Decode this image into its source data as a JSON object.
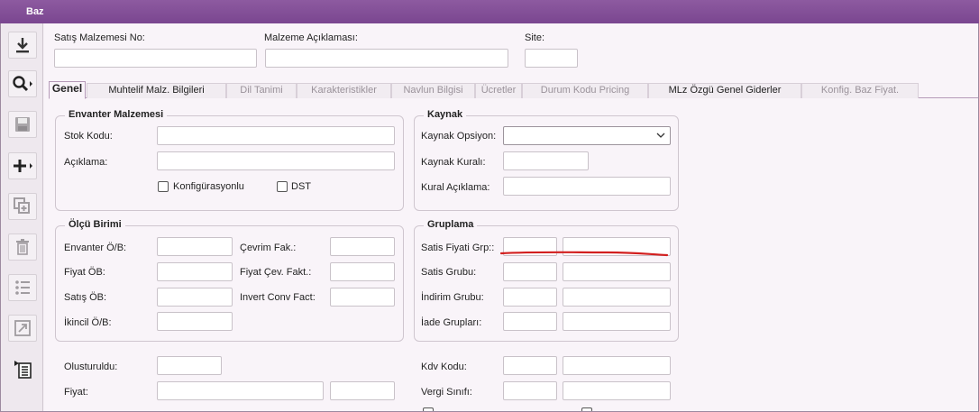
{
  "window": {
    "title": "Baz"
  },
  "toolbar": {
    "icons": [
      "download-icon",
      "search-icon",
      "save-icon",
      "add-icon",
      "copy-icon",
      "delete-icon",
      "list-icon",
      "resize-icon",
      "report-icon"
    ]
  },
  "header": {
    "sales_material_no_label": "Satış Malzemesi No:",
    "sales_material_no_value": "",
    "material_desc_label": "Malzeme Açıklaması:",
    "material_desc_value": "",
    "site_label": "Site:",
    "site_value": ""
  },
  "tabs": [
    {
      "label": "Genel"
    },
    {
      "label": "Muhtelif Malz. Bilgileri"
    },
    {
      "label": "Dil Tanimi"
    },
    {
      "label": "Karakteristikler"
    },
    {
      "label": "Navlun Bilgisi"
    },
    {
      "label": "Ücretler"
    },
    {
      "label": "Durum Kodu Pricing"
    },
    {
      "label": "MLz  Özgü Genel Giderler"
    },
    {
      "label": "Konfig. Baz Fiyat."
    }
  ],
  "inventory": {
    "title": "Envanter Malzemesi",
    "stock_code_label": "Stok Kodu:",
    "stock_code_value": "",
    "desc_label": "Açıklama:",
    "desc_value": "",
    "configured_label": "Konfigürasyonlu",
    "dst_label": "DST"
  },
  "source": {
    "title": "Kaynak",
    "option_label": "Kaynak Opsiyon:",
    "option_value": "",
    "rule_label": "Kaynak Kuralı:",
    "rule_value": "",
    "rule_desc_label": "Kural Açıklama:",
    "rule_desc_value": ""
  },
  "units": {
    "title": "Ölçü Birimi",
    "inv_label": "Envanter Ö/B:",
    "price_label": "Fiyat ÖB:",
    "sales_label": "Satış ÖB:",
    "secondary_label": "İkincil Ö/B:",
    "conv_label": "Çevrim Fak.:",
    "price_conv_label": "Fiyat Çev. Fakt.:",
    "invert_label": "Invert Conv Fact:"
  },
  "grouping": {
    "title": "Gruplama",
    "price_grp_label": "Satis Fiyati Grp::",
    "sales_grp_label": "Satis Grubu:",
    "discount_grp_label": "İndirim Grubu:",
    "return_grp_label": "İade Grupları:"
  },
  "bottom": {
    "created_label": "Olusturuldu:",
    "price_label": "Fiyat:",
    "vat_label": "Kdv Kodu:",
    "tax_class_label": "Vergi Sınıfı:"
  },
  "colors": {
    "titlebar": "#7a4690",
    "annotation": "#d21f1f"
  }
}
